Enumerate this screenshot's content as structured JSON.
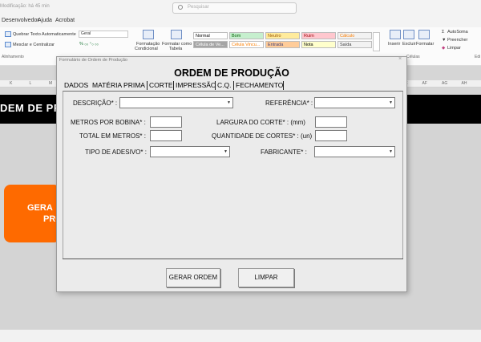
{
  "window": {
    "title": "Modificação: há 45 min",
    "search_placeholder": "Pesquisar"
  },
  "menu": [
    "Desenvolvedor",
    "Ajuda",
    "Acrobat"
  ],
  "ribbon": {
    "wrap_text": "Quebrar Texto Automaticamente",
    "merge_center": "Mesclar e Centralizar",
    "alignment_group": "Alinhamento",
    "number_format": "Geral",
    "conditional_1": "Formatação",
    "conditional_2": "Condicional",
    "format_table_1": "Formatar como",
    "format_table_2": "Tabela",
    "styles": [
      {
        "label": "Normal",
        "bg": "#ffffff",
        "fg": "#000000"
      },
      {
        "label": "Bom",
        "bg": "#c6efce",
        "fg": "#006100"
      },
      {
        "label": "Neutro",
        "bg": "#ffeb9c",
        "fg": "#9c5700"
      },
      {
        "label": "Ruim",
        "bg": "#ffc7ce",
        "fg": "#9c0006"
      },
      {
        "label": "Cálculo",
        "bg": "#f2f2f2",
        "fg": "#fa7d00"
      },
      {
        "label": "Célula de Ve...",
        "bg": "#a5a5a5",
        "fg": "#ffffff"
      },
      {
        "label": "Célula Vincu...",
        "bg": "#ffffff",
        "fg": "#fa7d00"
      },
      {
        "label": "Entrada",
        "bg": "#ffcc99",
        "fg": "#3f3f76"
      },
      {
        "label": "Nota",
        "bg": "#ffffcc",
        "fg": "#000000"
      },
      {
        "label": "Saída",
        "bg": "#f2f2f2",
        "fg": "#3f3f3f"
      }
    ],
    "insert": "Inserir",
    "delete": "Excluir",
    "format": "Formatar",
    "cells_group": "Células",
    "autosum": "AutoSoma",
    "fill": "Preencher",
    "clear": "Limpar",
    "edit_group": "Edi"
  },
  "columns": [
    "K",
    "L",
    "M",
    "N",
    "O",
    "P",
    "Q",
    "R",
    "S",
    "T",
    "U",
    "V",
    "W",
    "X",
    "Y",
    "Z",
    "AA",
    "AB",
    "AC",
    "AD",
    "AE",
    "AF",
    "AG",
    "AH"
  ],
  "sheet": {
    "band_text": "DEM DE PR",
    "orange_line1": "GERA",
    "orange_line2": "PRO"
  },
  "dialog": {
    "caption": "Formulário de Ordem de Produção",
    "close": "×",
    "heading": "ORDEM DE PRODUÇÃO",
    "tabs": [
      "DADOS",
      "MATÉRIA PRIMA",
      "CORTE",
      "IMPRESSÃO",
      "C.Q.",
      "FECHAMENTO"
    ],
    "fields": {
      "descricao": "DESCRIÇÃO* :",
      "referencia": "REFERÊNCIA* :",
      "metros_bobina": "METROS POR BOBINA* :",
      "largura_corte": "LARGURA DO CORTE* : (mm)",
      "total_metros": "TOTAL EM METROS* :",
      "quantidade_cortes": "QUANTIDADE DE CORTES* : (un)",
      "tipo_adesivo": "TIPO DE ADESIVO* :",
      "fabricante": "FABRICANTE* :"
    },
    "buttons": {
      "gerar": "GERAR ORDEM",
      "limpar": "LIMPAR"
    }
  }
}
